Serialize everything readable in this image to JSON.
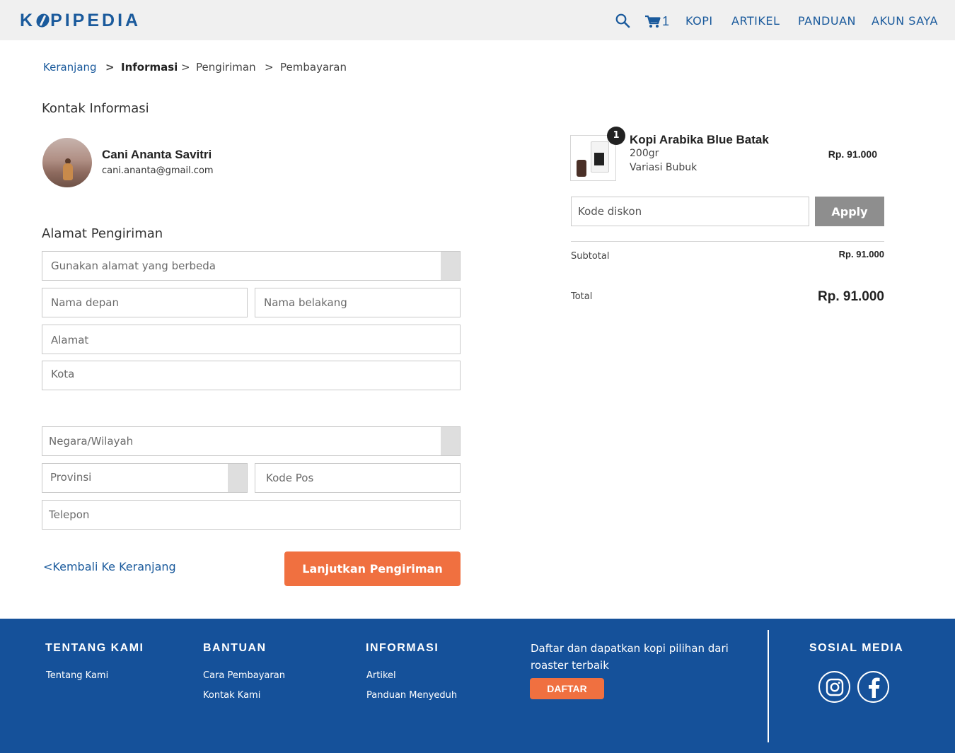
{
  "header": {
    "logo": "KOPIPEDIA",
    "logo_before": "K",
    "logo_after": "PIPEDIA",
    "cart_count": "1",
    "nav": [
      "KOPI",
      "ARTIKEL",
      "PANDUAN",
      "AKUN SAYA"
    ]
  },
  "breadcrumb": {
    "items": [
      "Keranjang",
      "Informasi",
      "Pengiriman",
      "Pembayaran"
    ],
    "separator": ">"
  },
  "contact": {
    "title": "Kontak Informasi",
    "name": "Cani Ananta Savitri",
    "email": "cani.ananta@gmail.com"
  },
  "shipping": {
    "title": "Alamat Pengiriman",
    "address_select": "Gunakan alamat yang berbeda",
    "first_name": "Nama depan",
    "last_name": "Nama belakang",
    "address": "Alamat",
    "city": "Kota",
    "country": "Negara/Wilayah",
    "province": "Provinsi",
    "postal_code": "Kode Pos",
    "phone": "Telepon"
  },
  "actions": {
    "back": "<Kembali Ke Keranjang",
    "continue": "Lanjutkan Pengiriman"
  },
  "order": {
    "quantity": "1",
    "product_name": "Kopi Arabika Blue Batak",
    "weight": "200gr",
    "variant": "Variasi Bubuk",
    "price": "Rp. 91.000",
    "discount_placeholder": "Kode diskon",
    "apply": "Apply",
    "subtotal_label": "Subtotal",
    "subtotal_value": "Rp. 91.000",
    "total_label": "Total",
    "total_value": "Rp. 91.000"
  },
  "footer": {
    "about_title": "TENTANG KAMI",
    "about_links": [
      "Tentang Kami"
    ],
    "help_title": "BANTUAN",
    "help_links": [
      "Cara Pembayaran",
      "Kontak Kami"
    ],
    "info_title": "INFORMASI",
    "info_links": [
      "Artikel",
      "Panduan Menyeduh"
    ],
    "promo_text": "Daftar dan dapatkan kopi pilihan dari roaster terbaik",
    "register": "DAFTAR",
    "social_title": "SOSIAL MEDIA",
    "social_icons": [
      "instagram-icon",
      "facebook-icon"
    ]
  },
  "colors": {
    "brand": "#1a5a9c",
    "accent": "#f07040",
    "footer_bg": "#15519a",
    "header_bg": "#f0f0f0"
  }
}
